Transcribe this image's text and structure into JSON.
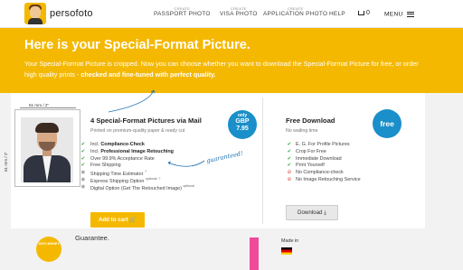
{
  "brand": {
    "name": "persofoto"
  },
  "nav": {
    "items": [
      {
        "small": "CREATE",
        "big": "PASSPORT PHOTO"
      },
      {
        "small": "CREATE",
        "big": "VISA PHOTO"
      },
      {
        "small": "CREATE",
        "big": "APPLICATION PHOTO"
      }
    ],
    "help": "HELP",
    "cart_count": "0",
    "menu": "MENU"
  },
  "hero": {
    "title": "Here is your Special-Format Picture.",
    "text_plain": "Your Special-Format Picture is cropped. Now you can choose whether you want to download the Special-Format Picture for free, or order high quality prints - ",
    "text_bold": "checked and fine-tuned with perfect quality."
  },
  "photo": {
    "width_label": "51 mm / 2\"",
    "height_label": "51 mm / 2\""
  },
  "paid": {
    "title": "4 Special-Format Pictures via Mail",
    "subtitle": "Printed on premium-quality paper & ready cut",
    "badge": {
      "line1": "only",
      "line2": "GBP",
      "line3": "7.95"
    },
    "features": [
      {
        "icon": "check",
        "prefix": "Incl. ",
        "bold": "Compliance-Check",
        "suffix": "",
        "sup": ""
      },
      {
        "icon": "check",
        "prefix": "Incl. ",
        "bold": "Professional Image Retouching",
        "suffix": "",
        "sup": ""
      },
      {
        "icon": "check",
        "prefix": "Over 99.9% Acceptance Rate",
        "bold": "",
        "suffix": "",
        "sup": ""
      },
      {
        "icon": "check",
        "prefix": "Free Shipping",
        "bold": "",
        "suffix": "",
        "sup": ""
      },
      {
        "icon": "info",
        "prefix": "Shipping Time Estimator",
        "bold": "",
        "suffix": "",
        "sup": "?"
      },
      {
        "icon": "info",
        "prefix": "Express Shipping Option",
        "bold": "",
        "suffix": "",
        "sup": "optional, ?"
      },
      {
        "icon": "info",
        "prefix": "Digital Option (Get The Retouched Image)",
        "bold": "",
        "suffix": "",
        "sup": "optional"
      }
    ],
    "guaranteed": "guaranteed!",
    "cta": "Add to cart"
  },
  "free": {
    "title": "Free Download",
    "subtitle": "No waiting time",
    "badge": "free",
    "features": [
      {
        "icon": "check",
        "text": "E. G. For Profile Pictures"
      },
      {
        "icon": "check",
        "text": "Crop For Free"
      },
      {
        "icon": "check",
        "text": "Immediate Download"
      },
      {
        "icon": "check",
        "text": "Print Yourself"
      },
      {
        "icon": "no",
        "text": "No Compliance-check"
      },
      {
        "icon": "no",
        "text": "No Image Retouching Service"
      }
    ],
    "cta": "Download"
  },
  "bottom": {
    "seal_text": "100% MONEY",
    "guarantee": "Guarantee.",
    "made_in": "Made in"
  },
  "colors": {
    "accent": "#f5b800",
    "badge_blue": "#1a8fc9",
    "ok_green": "#2eaa3e",
    "no_red": "#d23a2e"
  }
}
